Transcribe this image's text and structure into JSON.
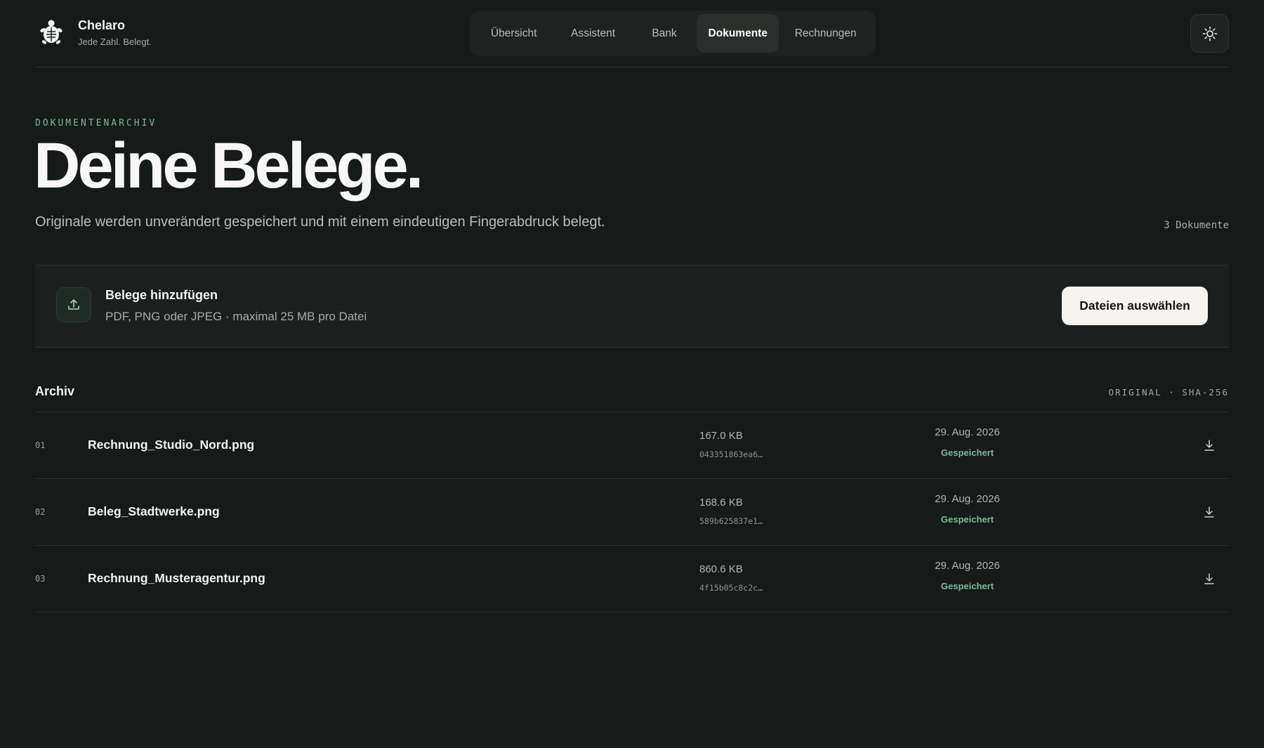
{
  "brand": {
    "name": "Chelaro",
    "tagline": "Jede Zahl. Belegt."
  },
  "nav": {
    "tabs": [
      {
        "label": "Übersicht",
        "active": false
      },
      {
        "label": "Assistent",
        "active": false
      },
      {
        "label": "Bank",
        "active": false
      },
      {
        "label": "Dokumente",
        "active": true
      },
      {
        "label": "Rechnungen",
        "active": false
      }
    ]
  },
  "header": {
    "theme_toggle_icon": "sun-icon"
  },
  "hero": {
    "eyebrow": "DOKUMENTENARCHIV",
    "title": "Deine Belege.",
    "subtitle": "Originale werden unverändert gespeichert und mit einem eindeutigen Fingerabdruck belegt.",
    "doc_count": "3 Dokumente"
  },
  "upload": {
    "icon": "upload-icon",
    "title": "Belege hinzufügen",
    "hint": "PDF, PNG oder JPEG · maximal 25 MB pro Datei",
    "button_label": "Dateien auswählen"
  },
  "archive": {
    "title": "Archiv",
    "meta": "ORIGINAL · SHA-256",
    "rows": [
      {
        "num": "01",
        "name": "Rechnung_Studio_Nord.png",
        "size": "167.0 KB",
        "hash": "043351863ea6…",
        "date": "29. Aug. 2026",
        "status": "Gespeichert"
      },
      {
        "num": "02",
        "name": "Beleg_Stadtwerke.png",
        "size": "168.6 KB",
        "hash": "589b625837e1…",
        "date": "29. Aug. 2026",
        "status": "Gespeichert"
      },
      {
        "num": "03",
        "name": "Rechnung_Musteragentur.png",
        "size": "860.6 KB",
        "hash": "4f15b05c8c2c…",
        "date": "29. Aug. 2026",
        "status": "Gespeichert"
      }
    ]
  },
  "colors": {
    "background": "#161a18",
    "accent_green": "#7fb69a",
    "button_bg": "#f6f5f1"
  }
}
